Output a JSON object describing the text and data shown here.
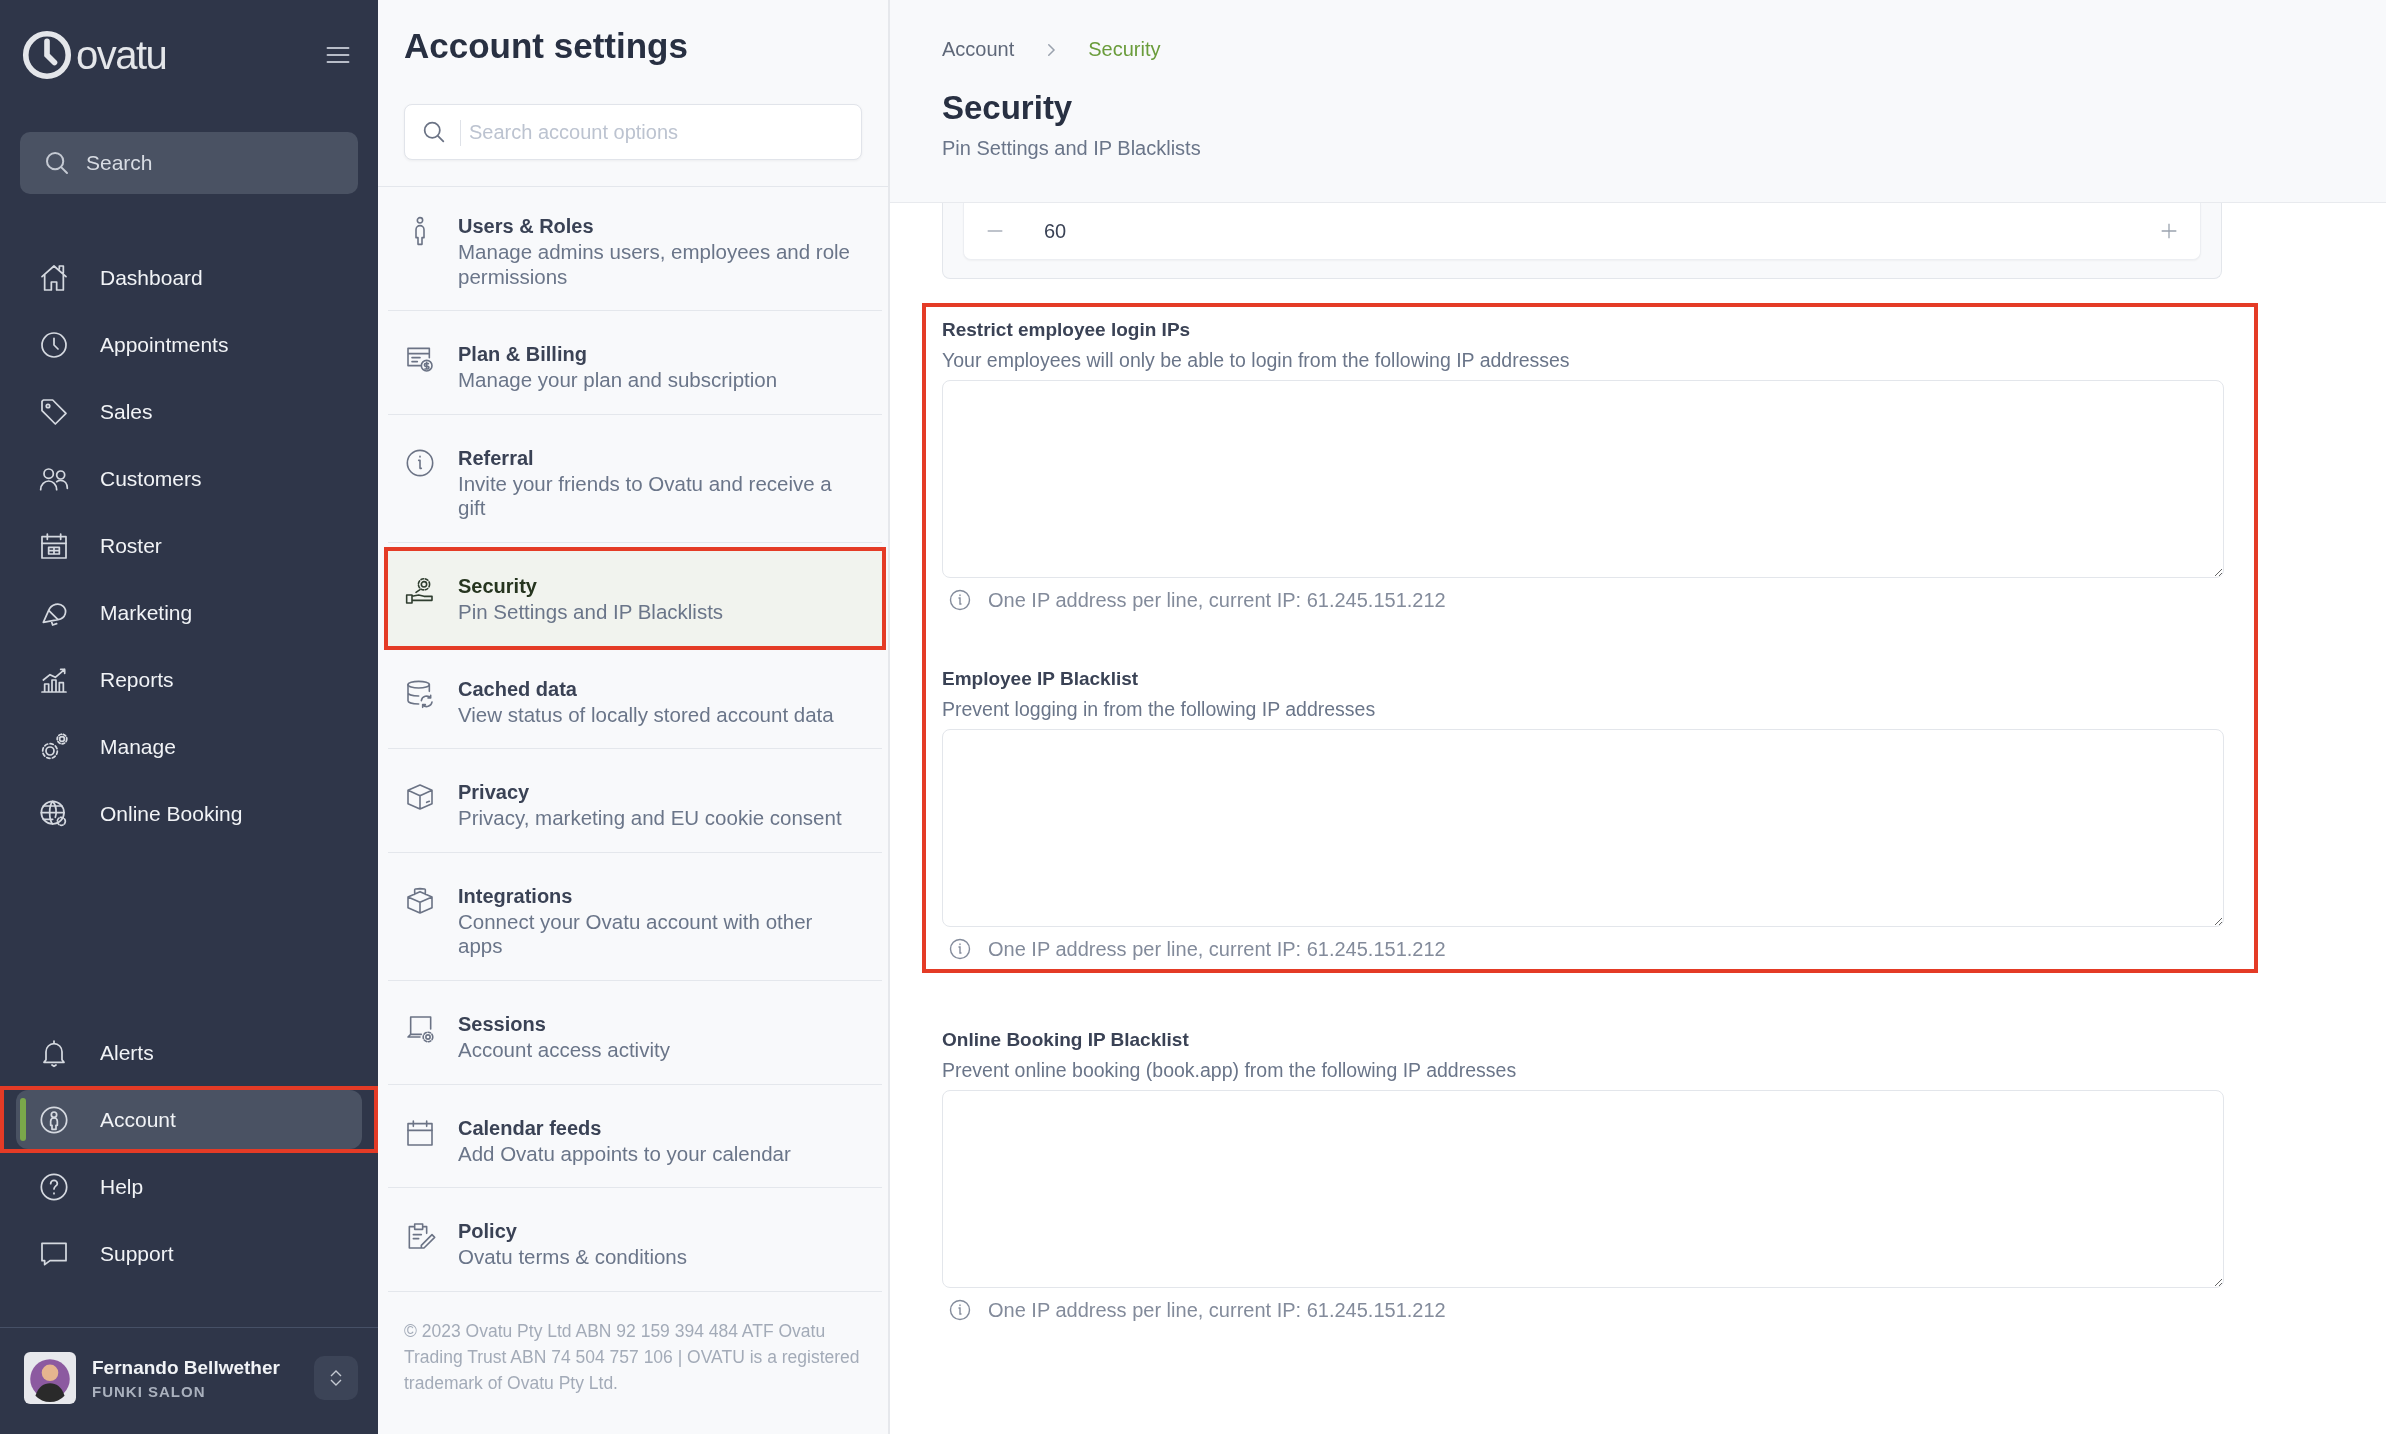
{
  "sidebar": {
    "logo": "ovatu",
    "search": {
      "placeholder": "Search"
    },
    "nav_items": [
      {
        "label": "Dashboard",
        "selected": false,
        "highlighted": false
      },
      {
        "label": "Appointments",
        "selected": false,
        "highlighted": false
      },
      {
        "label": "Sales",
        "selected": false,
        "highlighted": false
      },
      {
        "label": "Customers",
        "selected": false,
        "highlighted": false
      },
      {
        "label": "Roster",
        "selected": false,
        "highlighted": false
      },
      {
        "label": "Marketing",
        "selected": false,
        "highlighted": false
      },
      {
        "label": "Reports",
        "selected": false,
        "highlighted": false
      },
      {
        "label": "Manage",
        "selected": false,
        "highlighted": false
      },
      {
        "label": "Online Booking",
        "selected": false,
        "highlighted": false
      }
    ],
    "bottom_items": [
      {
        "label": "Alerts",
        "selected": false,
        "highlighted": false
      },
      {
        "label": "Account",
        "selected": true,
        "highlighted": true
      },
      {
        "label": "Help",
        "selected": false,
        "highlighted": false
      },
      {
        "label": "Support",
        "selected": false,
        "highlighted": false
      }
    ],
    "user": {
      "name": "Fernando Bellwether",
      "organization": "FUNKI SALON"
    }
  },
  "settings_panel": {
    "title": "Account settings",
    "search": {
      "placeholder": "Search account options"
    },
    "items": [
      {
        "title": "Users & Roles",
        "description": "Manage admins users, employees and role permissions",
        "selected": false,
        "highlighted": false
      },
      {
        "title": "Plan & Billing",
        "description": "Manage your plan and subscription",
        "selected": false,
        "highlighted": false
      },
      {
        "title": "Referral",
        "description": "Invite your friends to Ovatu and receive a gift",
        "selected": false,
        "highlighted": false
      },
      {
        "title": "Security",
        "description": "Pin Settings and IP Blacklists",
        "selected": true,
        "highlighted": true
      },
      {
        "title": "Cached data",
        "description": "View status of locally stored account data",
        "selected": false,
        "highlighted": false
      },
      {
        "title": "Privacy",
        "description": "Privacy, marketing and EU cookie consent",
        "selected": false,
        "highlighted": false
      },
      {
        "title": "Integrations",
        "description": "Connect your Ovatu account with other apps",
        "selected": false,
        "highlighted": false
      },
      {
        "title": "Sessions",
        "description": "Account access activity",
        "selected": false,
        "highlighted": false
      },
      {
        "title": "Calendar feeds",
        "description": "Add Ovatu appoints to your calendar",
        "selected": false,
        "highlighted": false
      },
      {
        "title": "Policy",
        "description": "Ovatu terms & conditions",
        "selected": false,
        "highlighted": false
      }
    ],
    "footer": "© 2023 Ovatu Pty Ltd ABN 92 159 394 484 ATF Ovatu Trading Trust ABN 74 504 757 106 | OVATU is a registered trademark of Ovatu Pty Ltd."
  },
  "content": {
    "breadcrumb": [
      {
        "label": "Account",
        "selected": false
      },
      {
        "label": "Security",
        "selected": true
      }
    ],
    "title": "Security",
    "subtitle": "Pin Settings and IP Blacklists",
    "stepper": {
      "value": "60"
    },
    "sections": [
      {
        "label": "Restrict employee login IPs",
        "description": "Your employees will only be able to login from the following IP addresses",
        "hint": "One IP address per line, current IP: 61.245.151.212",
        "highlighted": true
      },
      {
        "label": "Employee IP Blacklist",
        "description": "Prevent logging in from the following IP addresses",
        "hint": "One IP address per line, current IP: 61.245.151.212",
        "highlighted": true
      },
      {
        "label": "Online Booking IP Blacklist",
        "description": "Prevent online booking (book.app) from the following IP addresses",
        "hint": "One IP address per line, current IP: 61.245.151.212",
        "highlighted": false
      }
    ]
  }
}
